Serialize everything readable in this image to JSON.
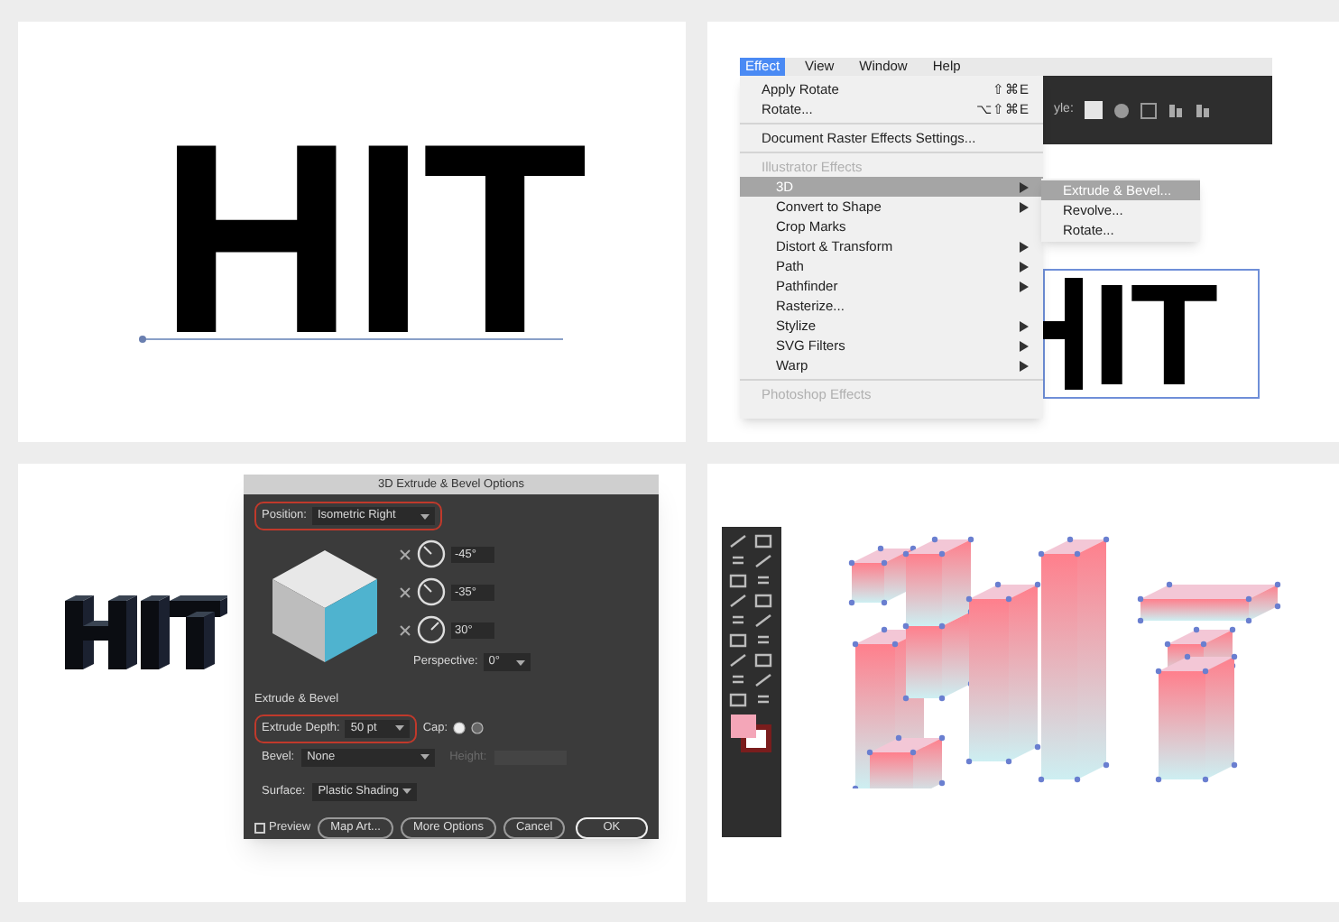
{
  "original_text": {
    "text": "HIT"
  },
  "effect_menu": {
    "menubar": [
      {
        "label": "Effect",
        "selected": true
      },
      {
        "label": "View",
        "selected": false
      },
      {
        "label": "Window",
        "selected": false
      },
      {
        "label": "Help",
        "selected": false
      }
    ],
    "toolbar_label": "yle:",
    "items": [
      {
        "kind": "item",
        "label": "Apply Rotate",
        "shortcut": "⇧⌘E"
      },
      {
        "kind": "item",
        "label": "Rotate...",
        "shortcut": "⌥⇧⌘E"
      },
      {
        "kind": "separator"
      },
      {
        "kind": "item",
        "label": "Document Raster Effects Settings..."
      },
      {
        "kind": "separator"
      },
      {
        "kind": "header",
        "label": "Illustrator Effects"
      },
      {
        "kind": "sub",
        "label": "3D",
        "has_submenu": true,
        "selected": true
      },
      {
        "kind": "sub",
        "label": "Convert to Shape",
        "has_submenu": true,
        "selected": false
      },
      {
        "kind": "sub",
        "label": "Crop Marks",
        "has_submenu": false,
        "selected": false
      },
      {
        "kind": "sub",
        "label": "Distort & Transform",
        "has_submenu": true,
        "selected": false
      },
      {
        "kind": "sub",
        "label": "Path",
        "has_submenu": true,
        "selected": false
      },
      {
        "kind": "sub",
        "label": "Pathfinder",
        "has_submenu": true,
        "selected": false
      },
      {
        "kind": "sub",
        "label": "Rasterize...",
        "has_submenu": false,
        "selected": false
      },
      {
        "kind": "sub",
        "label": "Stylize",
        "has_submenu": true,
        "selected": false
      },
      {
        "kind": "sub",
        "label": "SVG Filters",
        "has_submenu": true,
        "selected": false
      },
      {
        "kind": "sub",
        "label": "Warp",
        "has_submenu": true,
        "selected": false
      },
      {
        "kind": "separator"
      },
      {
        "kind": "header",
        "label": "Photoshop Effects"
      }
    ],
    "submenu": [
      {
        "label": "Extrude & Bevel...",
        "selected": true
      },
      {
        "label": "Revolve...",
        "selected": false
      },
      {
        "label": "Rotate...",
        "selected": false
      }
    ],
    "canvas_text": "IT"
  },
  "extrude_dialog": {
    "title": "3D Extrude & Bevel Options",
    "position": {
      "label": "Position:",
      "value": "Isometric Right",
      "highlighted": true
    },
    "rotations": [
      {
        "value": "-45°"
      },
      {
        "value": "-35°"
      },
      {
        "value": "30°"
      }
    ],
    "perspective": {
      "label": "Perspective:",
      "value": "0°"
    },
    "section": "Extrude & Bevel",
    "extrude_depth": {
      "label": "Extrude Depth:",
      "value": "50 pt",
      "highlighted": true
    },
    "cap": {
      "label": "Cap:",
      "on_selected": true
    },
    "bevel": {
      "label": "Bevel:",
      "value": "None"
    },
    "height": {
      "label": "Height:",
      "disabled": true
    },
    "surface": {
      "label": "Surface:",
      "value": "Plastic Shading"
    },
    "preview": {
      "label": "Preview",
      "checked": false
    },
    "buttons": [
      {
        "label": "Map Art...",
        "default": false
      },
      {
        "label": "More Options",
        "default": false
      },
      {
        "label": "Cancel",
        "default": false
      },
      {
        "label": "OK",
        "default": true
      }
    ]
  }
}
